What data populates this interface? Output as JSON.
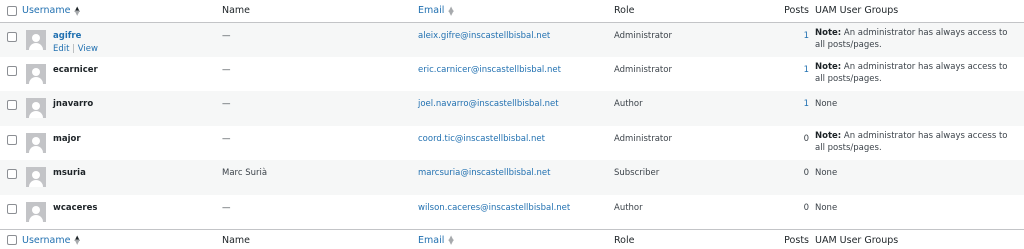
{
  "columns": {
    "username": "Username",
    "name": "Name",
    "email": "Email",
    "role": "Role",
    "posts": "Posts",
    "groups": "UAM User Groups"
  },
  "row_actions": {
    "edit": "Edit",
    "separator": "|",
    "view": "View"
  },
  "rows": [
    {
      "username": "agifre",
      "name": "—",
      "email": "aleix.gifre@inscastellbisbal.net",
      "role": "Administrator",
      "posts": "1",
      "groups_note_label": "Note:",
      "groups_note_text": " An administrator has always access to all posts/pages."
    },
    {
      "username": "ecarnicer",
      "name": "—",
      "email": "eric.carnicer@inscastellbisbal.net",
      "role": "Administrator",
      "posts": "1",
      "groups_note_label": "Note:",
      "groups_note_text": " An administrator has always access to all posts/pages."
    },
    {
      "username": "jnavarro",
      "name": "—",
      "email": "joel.navarro@inscastellbisbal.net",
      "role": "Author",
      "posts": "1",
      "groups": "None"
    },
    {
      "username": "major",
      "name": "—",
      "email": "coord.tic@inscastellbisbal.net",
      "role": "Administrator",
      "posts": "0",
      "groups_note_label": "Note:",
      "groups_note_text": " An administrator has always access to all posts/pages."
    },
    {
      "username": "msuria",
      "name": "Marc Surià",
      "email": "marcsuria@inscastellbisbal.net",
      "role": "Subscriber",
      "posts": "0",
      "groups": "None"
    },
    {
      "username": "wcaceres",
      "name": "—",
      "email": "wilson.caceres@inscastellbisbal.net",
      "role": "Author",
      "posts": "0",
      "groups": "None"
    }
  ],
  "colors": {
    "link": "#2271b1",
    "stripe": "#f6f7f7",
    "border": "#c3c4c7",
    "text": "#3c434a"
  },
  "icons": {
    "sort": "sort-arrows-icon",
    "avatar": "default-avatar-icon"
  }
}
